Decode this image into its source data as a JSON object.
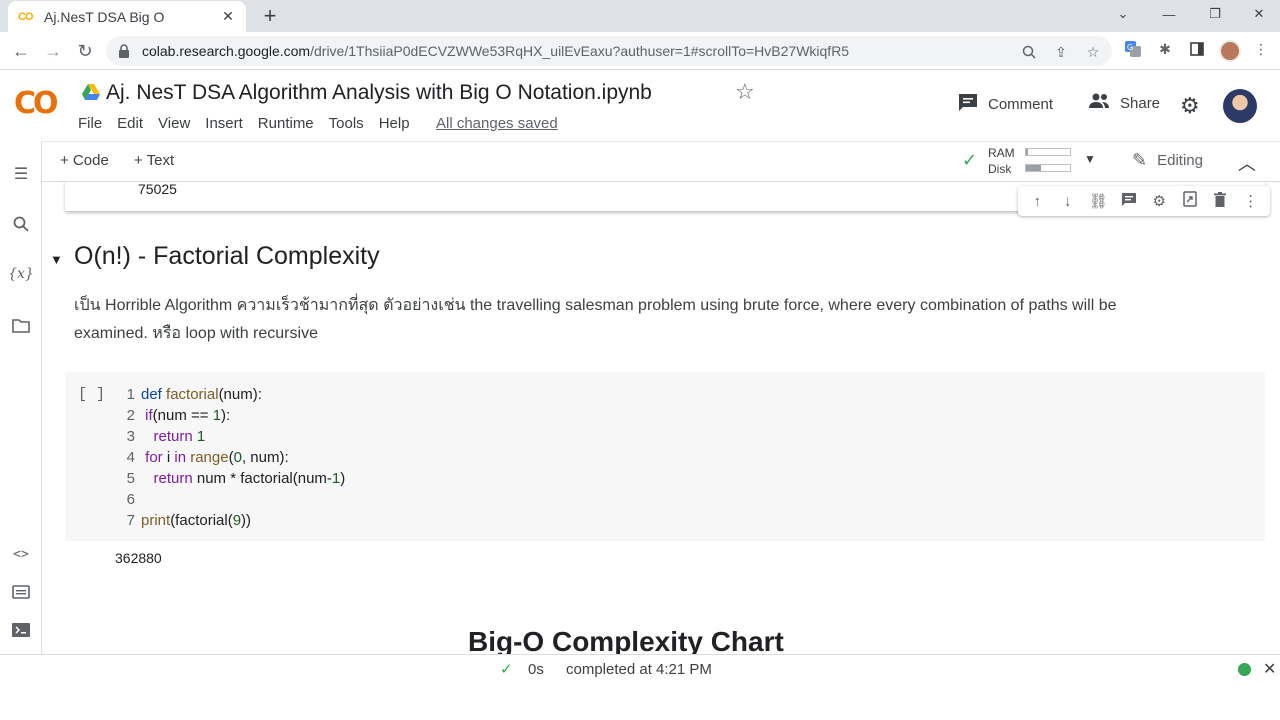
{
  "browser": {
    "tab_title": "Aj.NesT DSA Big O",
    "tab_favicon": "CO",
    "new_tab": "+",
    "url_host": "colab.research.google.com",
    "url_path": "/drive/1ThsiiaP0dECVZWWe53RqHX_uilEvEaxu?authuser=1#scrollTo=HvB27WkiqfR5"
  },
  "colab": {
    "logo": "CO",
    "title": "Aj. NesT DSA Algorithm Analysis with Big O Notation.ipynb",
    "menu": [
      "File",
      "Edit",
      "View",
      "Insert",
      "Runtime",
      "Tools",
      "Help"
    ],
    "saved": "All changes saved",
    "comment": "Comment",
    "share": "Share"
  },
  "toolbar": {
    "add_code": "+ Code",
    "add_text": "+ Text",
    "ram_label": "RAM",
    "disk_label": "Disk",
    "ram_usage": 0.05,
    "disk_usage": 0.35,
    "editing": "Editing"
  },
  "notebook": {
    "prev_output": "75025",
    "section_title": "O(n!) - Factorial Complexity",
    "paragraph": "เป็น Horrible Algorithm ความเร็วช้ามากที่สุด ตัวอย่างเช่น the travelling salesman problem using brute force, where every combination of paths will be examined. หรือ loop with recursive",
    "run_button": "[ ]",
    "code_lines": [
      {
        "n": "1"
      },
      {
        "n": "2"
      },
      {
        "n": "3"
      },
      {
        "n": "4"
      },
      {
        "n": "5"
      },
      {
        "n": "6"
      },
      {
        "n": "7"
      }
    ],
    "code_tokens": {
      "l1a": "def",
      "l1b": "factorial",
      "l1c": "(num):",
      "l2a": "if",
      "l2b": "(num == ",
      "l2c": "1",
      "l2d": "):",
      "l3a": "return",
      "l3b": "1",
      "l4a": "for",
      "l4b": " i ",
      "l4c": "in",
      "l4d": "range",
      "l4e": "(",
      "l4f": "0",
      "l4g": ", num):",
      "l5a": "return",
      "l5b": " num * factorial(num-",
      "l5c": "1",
      "l5d": ")",
      "l7a": "print",
      "l7b": "(factorial(",
      "l7c": "9",
      "l7d": "))"
    },
    "output": "362880",
    "chart_title": "Big-O Complexity Chart"
  },
  "status": {
    "time": "0s",
    "completed": "completed at 4:21 PM"
  },
  "colors": {
    "accent_green": "#34a853",
    "logo_yellow": "#f9ab00",
    "logo_orange": "#e8710a"
  }
}
